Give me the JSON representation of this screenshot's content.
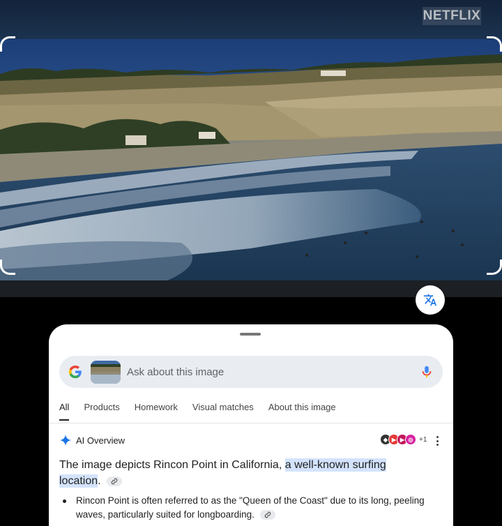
{
  "video": {
    "watermark": "NETFLIX"
  },
  "search": {
    "placeholder": "Ask about this image"
  },
  "tabs": [
    {
      "label": "All",
      "active": true
    },
    {
      "label": "Products",
      "active": false
    },
    {
      "label": "Homework",
      "active": false
    },
    {
      "label": "Visual matches",
      "active": false
    },
    {
      "label": "About this image",
      "active": false
    }
  ],
  "ai_overview": {
    "title": "AI Overview",
    "sources_more": "+1",
    "summary_plain": "The image depicts Rincon Point in California, ",
    "summary_highlight": "a well-known surfing location",
    "summary_end": ".",
    "bullet_1": "Rincon Point is often referred to as the \"Queen of the Coast\" due to its long, peeling waves, particularly suited for longboarding."
  },
  "colors": {
    "highlight": "#d3e3fd",
    "accent_blue": "#1a73e8",
    "sheet_bg": "#ffffff",
    "search_bg": "#e9ecf1"
  }
}
